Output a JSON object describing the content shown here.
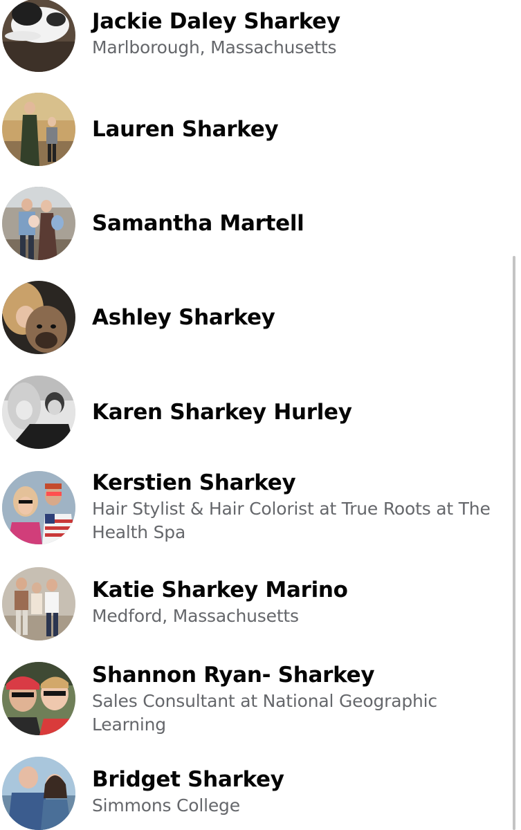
{
  "people": [
    {
      "name": "Jackie Daley Sharkey",
      "subtitle": "Marlborough, Massachusetts",
      "avatar": "dog-photo"
    },
    {
      "name": "Lauren Sharkey",
      "subtitle": "",
      "avatar": "people-outdoor-photo"
    },
    {
      "name": "Samantha Martell",
      "subtitle": "",
      "avatar": "family-photo"
    },
    {
      "name": "Ashley Sharkey",
      "subtitle": "",
      "avatar": "woman-with-dog-photo"
    },
    {
      "name": "Karen Sharkey Hurley",
      "subtitle": "",
      "avatar": "black-and-white-selfie-photo"
    },
    {
      "name": "Kerstien Sharkey",
      "subtitle": "Hair Stylist & Hair Colorist at True Roots at The Health Spa",
      "avatar": "couple-selfie-photo"
    },
    {
      "name": "Katie Sharkey Marino",
      "subtitle": "Medford, Massachusetts",
      "avatar": "group-indoor-photo"
    },
    {
      "name": "Shannon Ryan- Sharkey",
      "subtitle": "Sales Consultant at National Geographic Learning",
      "avatar": "mother-son-selfie-photo"
    },
    {
      "name": "Bridget Sharkey",
      "subtitle": "Simmons College",
      "avatar": "couple-waterfront-photo"
    }
  ]
}
